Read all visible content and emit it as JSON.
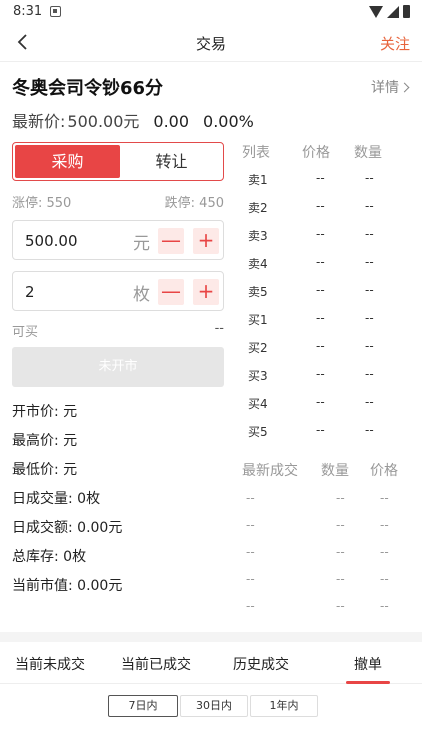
{
  "status_bar": {
    "time": "8:31"
  },
  "app_bar": {
    "title": "交易",
    "follow_label": "关注"
  },
  "product": {
    "name": "冬奥会司令钞66分",
    "detail_label": "详情",
    "price_label": "最新价:",
    "price": "500.00元",
    "change": "0.00",
    "change_pct": "0.00%"
  },
  "trade_panel": {
    "buy_label": "采购",
    "sell_label": "转让",
    "limit_up": "涨停: 550",
    "limit_down": "跌停: 450",
    "price_value": "500.00",
    "price_unit": "元",
    "qty_value": "2",
    "qty_unit": "枚",
    "minus": "—",
    "plus": "+",
    "available_label": "可买",
    "available_value": "--",
    "submit_label": "未开市"
  },
  "stats": [
    "开市价: 元",
    "最高价: 元",
    "最低价: 元",
    "日成交量: 0枚",
    "日成交额: 0.00元",
    "总库存: 0枚",
    "当前市值: 0.00元"
  ],
  "order_book": {
    "headers": [
      "列表",
      "价格",
      "数量"
    ],
    "rows": [
      {
        "label": "卖1",
        "price": "--",
        "qty": "--"
      },
      {
        "label": "卖2",
        "price": "--",
        "qty": "--"
      },
      {
        "label": "卖3",
        "price": "--",
        "qty": "--"
      },
      {
        "label": "卖4",
        "price": "--",
        "qty": "--"
      },
      {
        "label": "卖5",
        "price": "--",
        "qty": "--"
      },
      {
        "label": "买1",
        "price": "--",
        "qty": "--"
      },
      {
        "label": "买2",
        "price": "--",
        "qty": "--"
      },
      {
        "label": "买3",
        "price": "--",
        "qty": "--"
      },
      {
        "label": "买4",
        "price": "--",
        "qty": "--"
      },
      {
        "label": "买5",
        "price": "--",
        "qty": "--"
      }
    ]
  },
  "recent_trades": {
    "headers": [
      "最新成交",
      "数量",
      "价格"
    ],
    "rows": [
      [
        "--",
        "--",
        "--"
      ],
      [
        "--",
        "--",
        "--"
      ],
      [
        "--",
        "--",
        "--"
      ],
      [
        "--",
        "--",
        "--"
      ],
      [
        "--",
        "--",
        "--"
      ]
    ]
  },
  "tabs": [
    "当前未成交",
    "当前已成交",
    "历史成交",
    "撤单"
  ],
  "periods": [
    "7日内",
    "30日内",
    "1年内"
  ],
  "colors": {
    "accent": "#e84545",
    "follow": "#e8643c"
  }
}
